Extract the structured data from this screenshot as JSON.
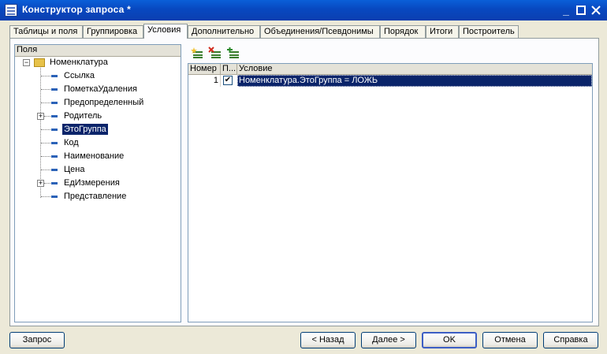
{
  "window": {
    "title": "Конструктор запроса *"
  },
  "tabs": [
    {
      "label": "Таблицы и поля"
    },
    {
      "label": "Группировка"
    },
    {
      "label": "Условия"
    },
    {
      "label": "Дополнительно"
    },
    {
      "label": "Объединения/Псевдонимы"
    },
    {
      "label": "Порядок"
    },
    {
      "label": "Итоги"
    },
    {
      "label": "Построитель"
    }
  ],
  "fields_panel": {
    "header": "Поля",
    "root": "Номенклатура",
    "items": [
      {
        "label": "Ссылка"
      },
      {
        "label": "ПометкаУдаления"
      },
      {
        "label": "Предопределенный"
      },
      {
        "label": "Родитель"
      },
      {
        "label": "ЭтоГруппа"
      },
      {
        "label": "Код"
      },
      {
        "label": "Наименование"
      },
      {
        "label": "Цена"
      },
      {
        "label": "ЕдИзмерения"
      },
      {
        "label": "Представление"
      }
    ]
  },
  "conditions": {
    "columns": {
      "number": "Номер",
      "flag": "П...",
      "condition": "Условие"
    },
    "rows": [
      {
        "number": "1",
        "checked": "✔",
        "condition": "Номенклатура.ЭтоГруппа = ЛОЖЬ"
      }
    ]
  },
  "buttons": {
    "query": "Запрос",
    "back": "< Назад",
    "next": "Далее >",
    "ok": "OK",
    "cancel": "Отмена",
    "help": "Справка"
  }
}
